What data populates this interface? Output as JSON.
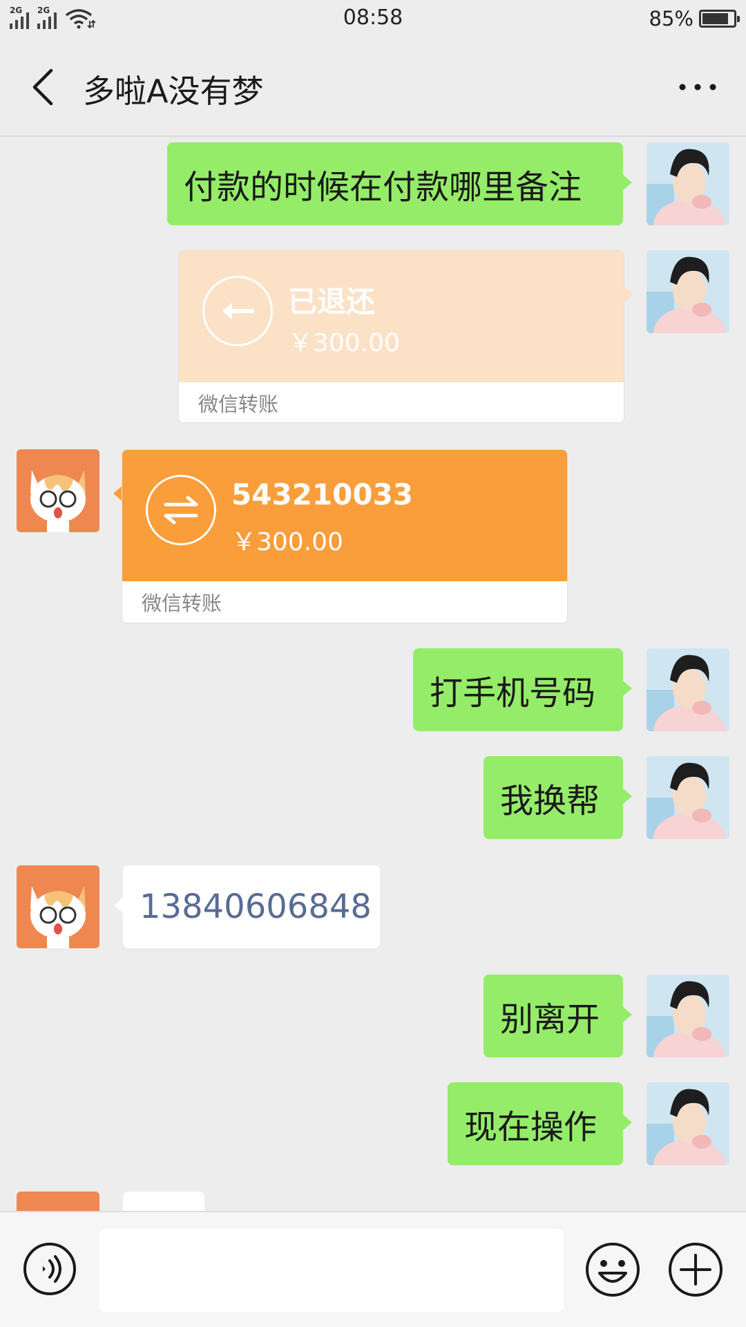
{
  "status_bar": {
    "sim1": "2G",
    "sim2": "2G",
    "time": "08:58",
    "battery": "85%",
    "battery_level": 0.85
  },
  "header": {
    "title": "多啦A没有梦",
    "icons": [
      "back-icon",
      "more-icon"
    ]
  },
  "messages": [
    {
      "side": "right",
      "type": "text",
      "text": "付款的时候在付款哪里备注"
    },
    {
      "side": "right",
      "type": "transfer",
      "title": "已退还",
      "amount": "￥300.00",
      "footer": "微信转账",
      "icon": "return-arrow-icon",
      "color": "#fbe1c6"
    },
    {
      "side": "left",
      "type": "transfer",
      "title": "543210033",
      "amount": "￥300.00",
      "footer": "微信转账",
      "icon": "transfer-icon",
      "color": "#fa9d3b"
    },
    {
      "side": "right",
      "type": "text",
      "text": "打手机号码"
    },
    {
      "side": "right",
      "type": "text",
      "text": "我换帮"
    },
    {
      "side": "left",
      "type": "text",
      "text": "13840606848"
    },
    {
      "side": "right",
      "type": "text",
      "text": "别离开"
    },
    {
      "side": "right",
      "type": "text",
      "text": "现在操作"
    }
  ],
  "input_bar": {
    "placeholder": "",
    "icons": [
      "voice-icon",
      "emoji-icon",
      "plus-icon"
    ]
  },
  "colors": {
    "background": "#ededed",
    "bubble_self": "#95ec69",
    "bubble_other": "#ffffff",
    "link_text": "#576b95",
    "transfer_refunded": "#fbe1c6",
    "transfer_pending": "#fa9d3b"
  }
}
